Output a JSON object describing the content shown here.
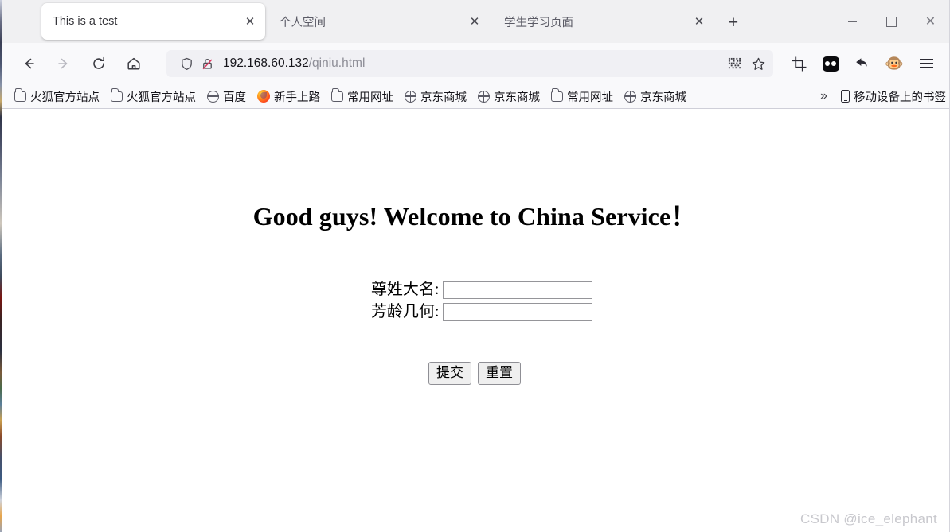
{
  "window": {
    "controls": {
      "minimize": "–",
      "maximize": "□",
      "close": "✕"
    }
  },
  "tabs": [
    {
      "title": "This is a test",
      "active": true,
      "close": "✕"
    },
    {
      "title": "个人空间",
      "active": false,
      "close": "✕"
    },
    {
      "title": "学生学习页面",
      "active": false,
      "close": "✕"
    }
  ],
  "new_tab_label": "+",
  "toolbar": {
    "back": "←",
    "forward": "→",
    "reload": "↻",
    "home": "⌂",
    "shield_icon": "shield-icon",
    "lock_broken_icon": "lock-crossed-icon",
    "url_host": "192.168.60.132",
    "url_path": "/qiniu.html",
    "qr_icon": "qr-code-icon",
    "bookmark_star": "☆",
    "screenshot_icon": "crop-icon",
    "pocket_icon": "pocket-extension-icon",
    "undo_icon": "↩",
    "monkey_icon": "🐵",
    "menu_icon": "hamburger-menu-icon"
  },
  "bookmarks": {
    "items": [
      {
        "label": "火狐官方站点",
        "icon": "folder"
      },
      {
        "label": "火狐官方站点",
        "icon": "folder"
      },
      {
        "label": "百度",
        "icon": "globe"
      },
      {
        "label": "新手上路",
        "icon": "firefox"
      },
      {
        "label": "常用网址",
        "icon": "folder"
      },
      {
        "label": "京东商城",
        "icon": "globe"
      },
      {
        "label": "京东商城",
        "icon": "globe"
      },
      {
        "label": "常用网址",
        "icon": "folder"
      },
      {
        "label": "京东商城",
        "icon": "globe"
      }
    ],
    "overflow": "»",
    "mobile": {
      "label": "移动设备上的书签",
      "icon": "phone"
    }
  },
  "page": {
    "heading": "Good guys! Welcome to China Service！",
    "fields": [
      {
        "label": "尊姓大名:",
        "value": "",
        "placeholder": ""
      },
      {
        "label": "芳龄几何:",
        "value": "",
        "placeholder": ""
      }
    ],
    "buttons": {
      "submit": "提交",
      "reset": "重置"
    },
    "watermark": "CSDN @ice_elephant"
  }
}
